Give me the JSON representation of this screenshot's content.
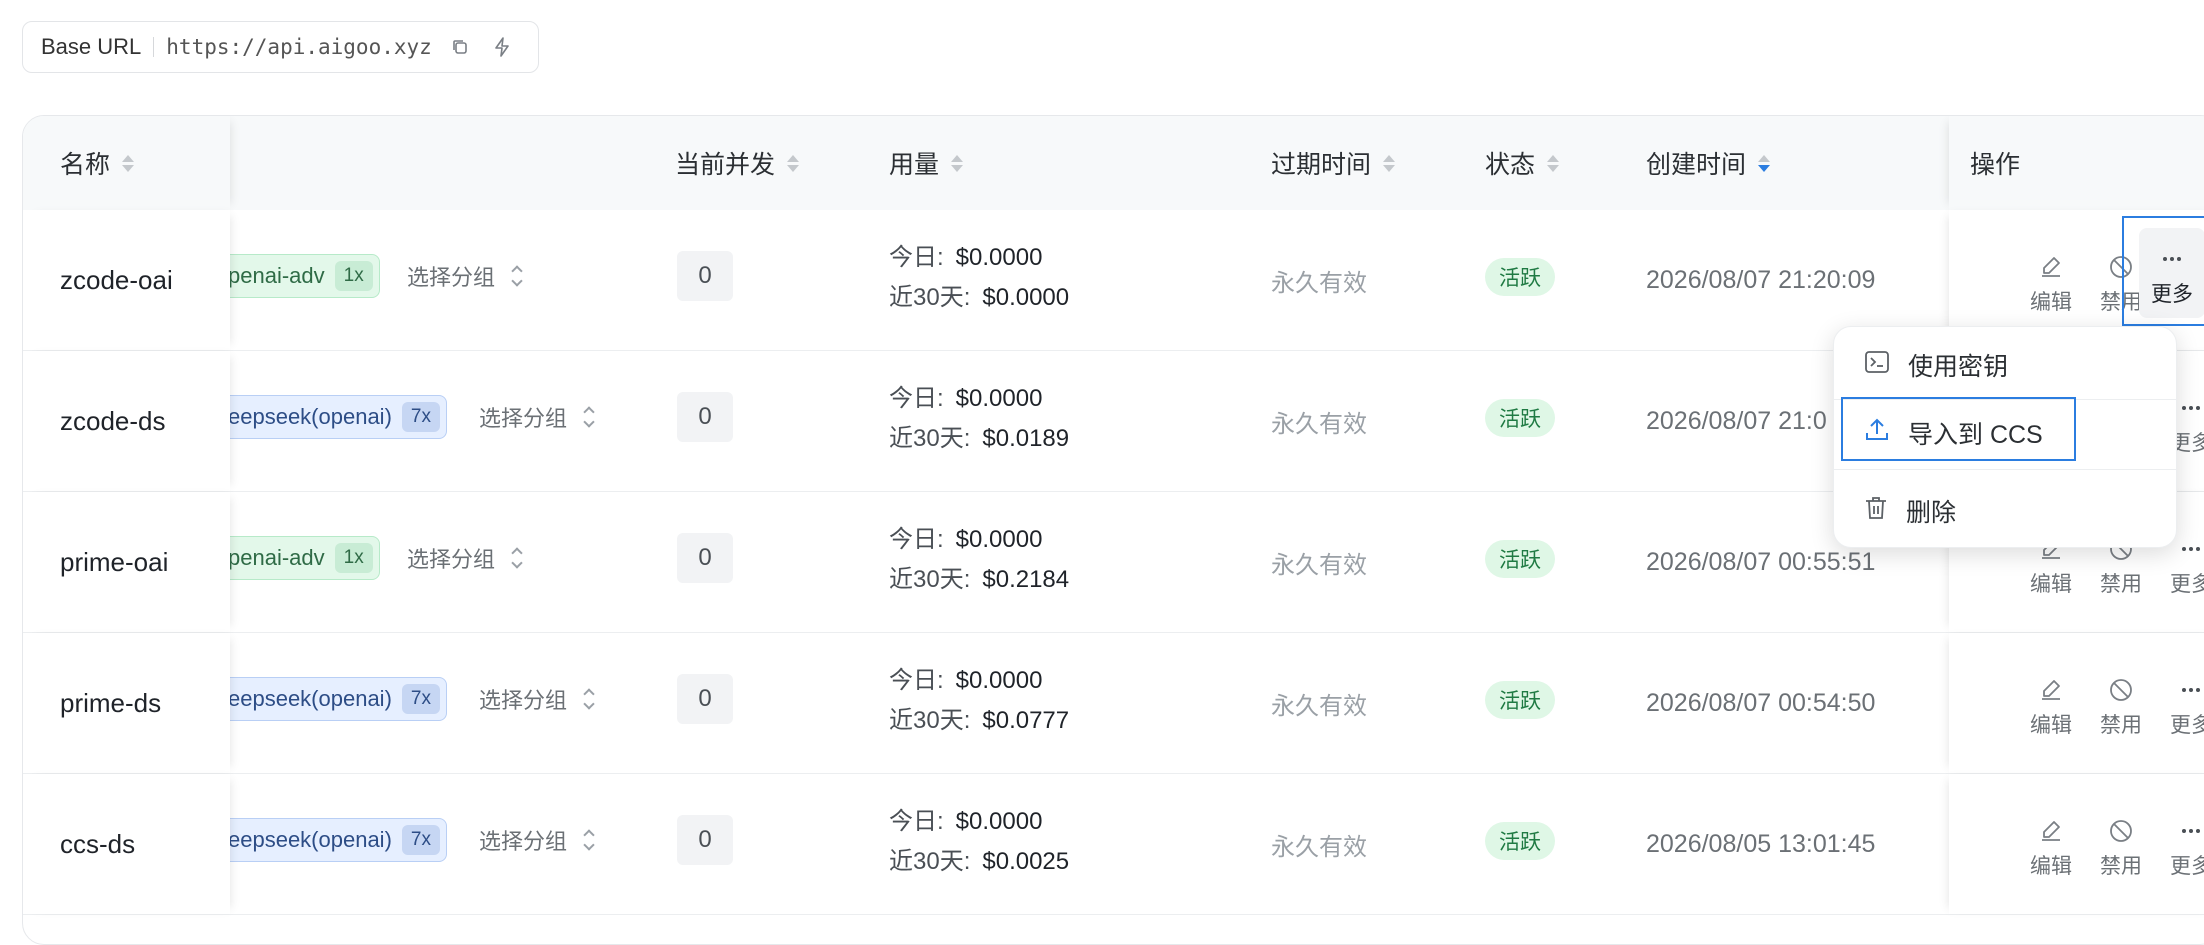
{
  "base_url": {
    "label": "Base URL",
    "url": "https://api.aigoo.xyz"
  },
  "table": {
    "columns": {
      "name": "名称",
      "concurrency": "当前并发",
      "usage": "用量",
      "expire": "过期时间",
      "status": "状态",
      "created": "创建时间",
      "ops": "操作"
    },
    "rows": [
      {
        "name": "zcode-oai",
        "group": "penai-adv",
        "mult": "1x",
        "group_color": "green",
        "select_group": "选择分组",
        "concurrency": "0",
        "today_label": "今日:",
        "today": "$0.0000",
        "month_label": "近30天:",
        "month": "$0.0000",
        "expire": "永久有效",
        "status": "活跃",
        "created": "2026/08/07 21:20:09"
      },
      {
        "name": "zcode-ds",
        "group": "eepseek(openai)",
        "mult": "7x",
        "group_color": "blue",
        "select_group": "选择分组",
        "concurrency": "0",
        "today_label": "今日:",
        "today": "$0.0000",
        "month_label": "近30天:",
        "month": "$0.0189",
        "expire": "永久有效",
        "status": "活跃",
        "created": "2026/08/07 21:0"
      },
      {
        "name": "prime-oai",
        "group": "penai-adv",
        "mult": "1x",
        "group_color": "green",
        "select_group": "选择分组",
        "concurrency": "0",
        "today_label": "今日:",
        "today": "$0.0000",
        "month_label": "近30天:",
        "month": "$0.2184",
        "expire": "永久有效",
        "status": "活跃",
        "created": "2026/08/07 00:55:51"
      },
      {
        "name": "prime-ds",
        "group": "eepseek(openai)",
        "mult": "7x",
        "group_color": "blue",
        "select_group": "选择分组",
        "concurrency": "0",
        "today_label": "今日:",
        "today": "$0.0000",
        "month_label": "近30天:",
        "month": "$0.0777",
        "expire": "永久有效",
        "status": "活跃",
        "created": "2026/08/07 00:54:50"
      },
      {
        "name": "ccs-ds",
        "group": "eepseek(openai)",
        "mult": "7x",
        "group_color": "blue",
        "select_group": "选择分组",
        "concurrency": "0",
        "today_label": "今日:",
        "today": "$0.0000",
        "month_label": "近30天:",
        "month": "$0.0025",
        "expire": "永久有效",
        "status": "活跃",
        "created": "2026/08/05 13:01:45"
      }
    ],
    "ops": {
      "edit": "编辑",
      "disable": "禁用",
      "more": "更多"
    }
  },
  "dropdown": {
    "use_key": "使用密钥",
    "import_ccs": "导入到 CCS",
    "delete": "删除"
  },
  "colors": {
    "accent": "#2b7de0",
    "status_bg": "#dff7e6",
    "status_text": "#1f7a43"
  }
}
